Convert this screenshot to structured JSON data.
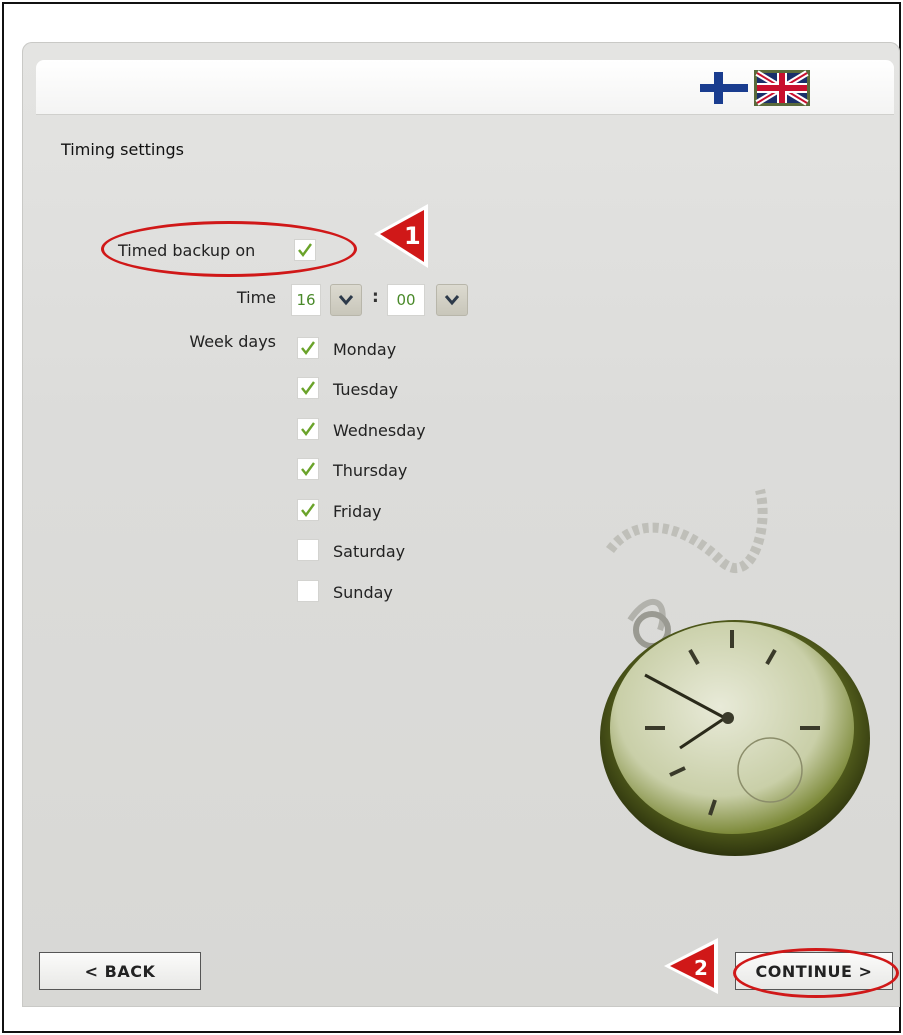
{
  "header": {
    "languages": [
      {
        "code": "fi",
        "icon": "finnish-flag-icon"
      },
      {
        "code": "en",
        "icon": "uk-flag-icon"
      }
    ]
  },
  "page": {
    "title": "Timing settings"
  },
  "form": {
    "timed_backup_label": "Timed backup on",
    "timed_backup_checked": true,
    "time_label": "Time",
    "hour": "16",
    "minute": "00",
    "separator": ":",
    "weekdays_label": "Week days",
    "days": [
      {
        "label": "Monday",
        "checked": true
      },
      {
        "label": "Tuesday",
        "checked": true
      },
      {
        "label": "Wednesday",
        "checked": true
      },
      {
        "label": "Thursday",
        "checked": true
      },
      {
        "label": "Friday",
        "checked": true
      },
      {
        "label": "Saturday",
        "checked": false
      },
      {
        "label": "Sunday",
        "checked": false
      }
    ]
  },
  "footer": {
    "back_label": "< BACK",
    "continue_label": "CONTINUE >"
  },
  "annotations": {
    "marker_1": "1",
    "marker_2": "2",
    "highlight_color": "#d01818"
  },
  "colors": {
    "check_green": "#6aa32a",
    "time_text": "#4a8a2a"
  }
}
